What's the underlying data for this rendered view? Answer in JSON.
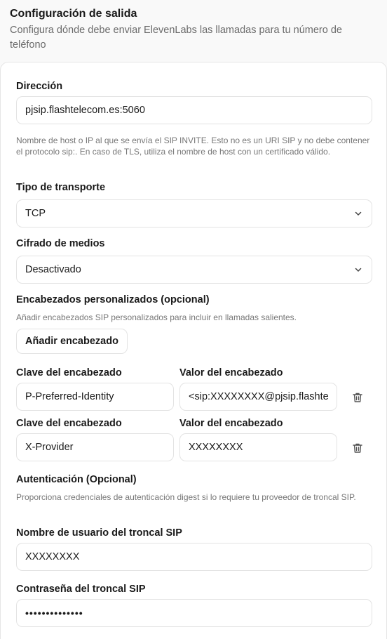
{
  "section": {
    "title": "Configuración de salida",
    "description": "Configura dónde debe enviar ElevenLabs las llamadas para tu número de teléfono"
  },
  "address": {
    "label": "Dirección",
    "value": "pjsip.flashtelecom.es:5060",
    "help": "Nombre de host o IP al que se envía el SIP INVITE. Esto no es un URI SIP y no debe contener el protocolo sip:. En caso de TLS, utiliza el nombre de host con un certificado válido."
  },
  "transport": {
    "label": "Tipo de transporte",
    "value": "TCP"
  },
  "encryption": {
    "label": "Cifrado de medios",
    "value": "Desactivado"
  },
  "custom_headers": {
    "label": "Encabezados personalizados (opcional)",
    "help": "Añadir encabezados SIP personalizados para incluir en llamadas salientes.",
    "add_button": "Añadir encabezado",
    "rows": [
      {
        "key_label": "Clave del encabezado",
        "key": "P-Preferred-Identity",
        "value_label": "Valor del encabezado",
        "value": "<sip:XXXXXXXX@pjsip.flashtelecom.es>"
      },
      {
        "key_label": "Clave del encabezado",
        "key": "X-Provider",
        "value_label": "Valor del encabezado",
        "value": "XXXXXXXX"
      }
    ]
  },
  "auth": {
    "label": "Autenticación (Opcional)",
    "help": "Proporciona credenciales de autenticación digest si lo requiere tu proveedor de troncal SIP.",
    "username_label": "Nombre de usuario del troncal SIP",
    "username": "XXXXXXXX",
    "password_label": "Contraseña del troncal SIP",
    "password_mask": "••••••••••••••"
  },
  "icons": {
    "select": "chevron-down-icon",
    "delete": "trash-icon"
  }
}
